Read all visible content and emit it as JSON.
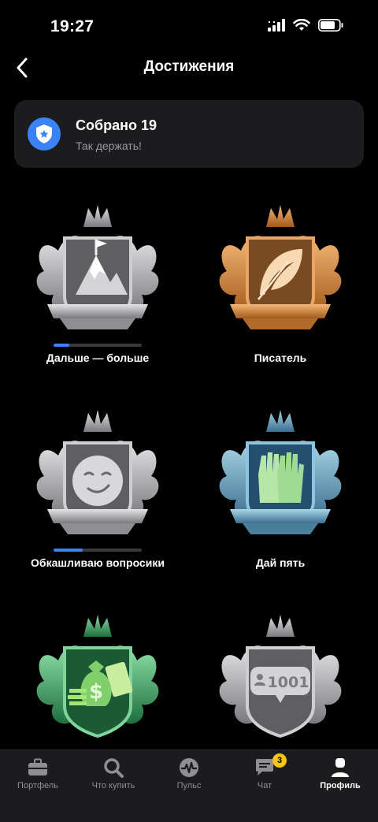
{
  "status_bar": {
    "time": "19:27"
  },
  "nav": {
    "title": "Достижения"
  },
  "summary": {
    "title": "Собрано 19",
    "subtitle": "Так держать!"
  },
  "achievements": [
    {
      "label": "Дальше — больше",
      "theme": "silver",
      "icon": "mountain-flag-icon",
      "progress": 0.18
    },
    {
      "label": "Писатель",
      "theme": "bronze",
      "icon": "feather-icon",
      "progress": null
    },
    {
      "label": "Обкашливаю вопросики",
      "theme": "silver",
      "icon": "smile-face-icon",
      "progress": 0.33
    },
    {
      "label": "Дай пять",
      "theme": "blue",
      "icon": "high-five-hands-icon",
      "progress": null
    },
    {
      "label": "",
      "theme": "green",
      "icon": "money-bag-icon",
      "progress": null
    },
    {
      "label": "",
      "theme": "silver",
      "icon": "counter-1001",
      "counter_text": "1001",
      "progress": null
    }
  ],
  "tab_bar": {
    "tabs": [
      {
        "label": "Портфель",
        "icon": "briefcase-icon"
      },
      {
        "label": "Что купить",
        "icon": "search-icon"
      },
      {
        "label": "Пульс",
        "icon": "pulse-icon"
      },
      {
        "label": "Чат",
        "icon": "chat-icon",
        "badge": "3"
      },
      {
        "label": "Профиль",
        "icon": "profile-icon",
        "active": true
      }
    ]
  },
  "colors": {
    "accent": "#3b82f6",
    "badge_yellow": "#f5c518",
    "card_bg": "#1c1c1e",
    "silver": "#b9b9bd",
    "bronze": "#d7883a",
    "blue": "#6aa6c8",
    "green": "#3fae6a"
  }
}
